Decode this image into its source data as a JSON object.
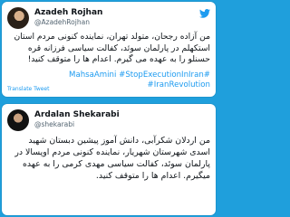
{
  "tweets": [
    {
      "author_name": "Azadeh Rojhan",
      "author_handle": "@AzadehRojhan",
      "text": "من آزاده رجحان، متولد تهران، نماینده کنونی مردم استان استکهلم در پارلمان سوئد، کفالت سیاسی فرزانه قره حسنلو را به عهده می گیرم. اعدام ها را متوقف کنید!",
      "hashtags": "#MahsaAmini‎ #StopExecutionInIran‎ #IranRevolution‎",
      "translate_label": "Translate Tweet"
    },
    {
      "author_name": "Ardalan Shekarabi",
      "author_handle": "@shekarabi",
      "text": "من اردلان شکرآبی، دانش آموز پیشین دبستان شهید اسدی شهرستان شهریار، نماینده کنونی مردم اوپسالا در پارلمان سوئد، کفالت سیاسی مهدی کرمی را به عهده میگیرم. اعدام ها را متوقف کنید."
    }
  ],
  "colors": {
    "background": "#1f9fdc",
    "card": "#ffffff",
    "link": "#1d9bf0",
    "handle": "#536471"
  },
  "icons": {
    "brand": "twitter-bird-icon"
  }
}
